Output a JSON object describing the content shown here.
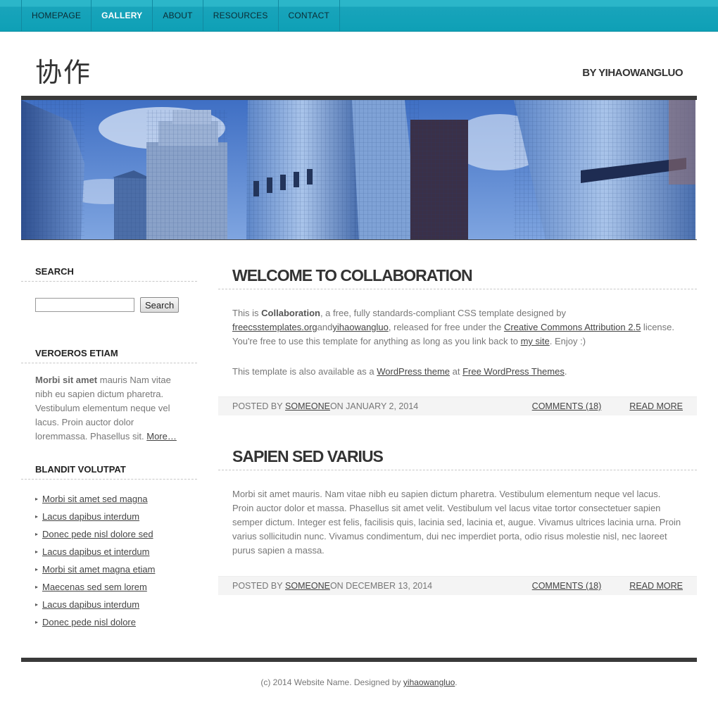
{
  "menu": {
    "items": [
      {
        "label": "HOMEPAGE"
      },
      {
        "label": "GALLERY"
      },
      {
        "label": "ABOUT"
      },
      {
        "label": "RESOURCES"
      },
      {
        "label": "CONTACT"
      }
    ],
    "active_index": 1
  },
  "header": {
    "logo": "协作",
    "byline": "BY YIHAOWANGLUO"
  },
  "banner": {
    "image": "city-skyscrapers"
  },
  "sidebar": {
    "search": {
      "heading": "SEARCH",
      "placeholder": "",
      "button": "Search"
    },
    "section2": {
      "heading": "VEROEROS ETIAM",
      "bold": "Morbi sit amet",
      "text": " mauris Nam vitae nibh eu sapien dictum pharetra. Vestibulum elementum neque vel lacus. Proin auctor dolor loremmassa. Phasellus sit. ",
      "more": "More…"
    },
    "section3": {
      "heading": "BLANDIT VOLUTPAT",
      "links": [
        "Morbi sit amet sed magna",
        "Lacus dapibus interdum",
        "Donec pede nisl dolore sed",
        "Lacus dapibus et interdum",
        "Morbi sit amet magna etiam",
        "Maecenas sed sem lorem",
        "Lacus dapibus interdum",
        "Donec pede nisl dolore"
      ]
    }
  },
  "posts": [
    {
      "title": "WELCOME TO COLLABORATION",
      "p1": {
        "t1": "This is ",
        "b1": "Collaboration",
        "t2": ", a free, fully standards-compliant CSS template designed by ",
        "l1": "freecsstemplates.org",
        "t3": "and",
        "l2": "yihaowangluo",
        "t4": ", released for free under the ",
        "l3": "Creative Commons Attribution 2.5",
        "t5": " license. You're free to use this template for anything as long as you link back to ",
        "l4": "my site",
        "t6": ". Enjoy :)"
      },
      "p2": {
        "t1": "This template is also available as a ",
        "l1": "WordPress theme",
        "t2": " at ",
        "l2": "Free WordPress Themes",
        "t3": "."
      },
      "meta": {
        "posted_by": "POSTED BY ",
        "author": "SOMEONE",
        "on": " ON JANUARY 2, 2014",
        "comments": "COMMENTS (18)",
        "read_more": "READ MORE"
      }
    },
    {
      "title": "SAPIEN SED VARIUS",
      "body": "Morbi sit amet mauris. Nam vitae nibh eu sapien dictum pharetra. Vestibulum elementum neque vel lacus. Proin auctor dolor et massa. Phasellus sit amet velit. Vestibulum vel lacus vitae tortor consectetuer sapien semper dictum. Integer est felis, facilisis quis, lacinia sed, lacinia et, augue. Vivamus ultrices lacinia urna. Proin varius sollicitudin nunc. Vivamus condimentum, dui nec imperdiet porta, odio risus molestie nisl, nec laoreet purus sapien a massa.",
      "meta": {
        "posted_by": "POSTED BY ",
        "author": "SOMEONE",
        "on": " ON DECEMBER 13, 2014",
        "comments": "COMMENTS (18)",
        "read_more": "READ MORE"
      }
    }
  ],
  "footer": {
    "text": "(c) 2014 Website Name. Designed by ",
    "link": "yihaowangluo",
    "end": "."
  },
  "colors": {
    "menu": "#19a4bb",
    "menu_active_text": "#ffffff",
    "dark_bar": "#3a3a3a"
  }
}
